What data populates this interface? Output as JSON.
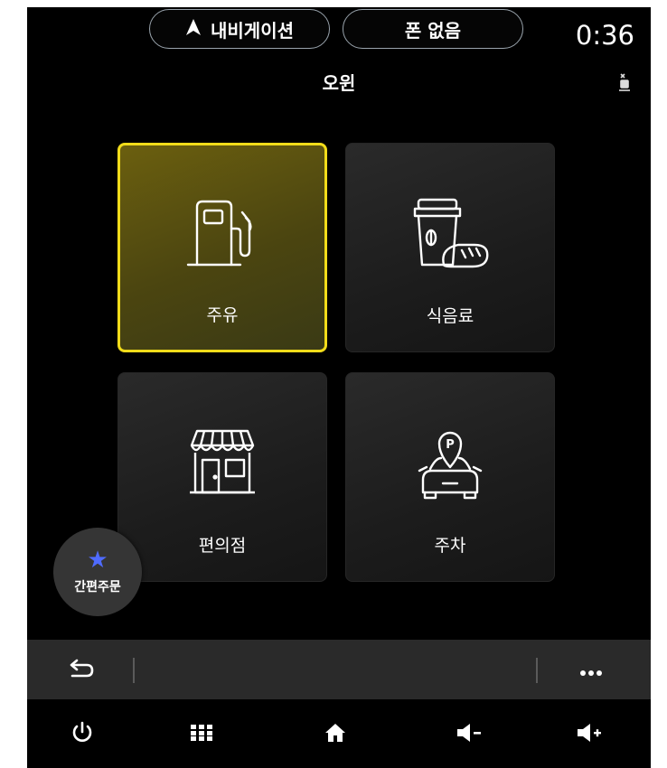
{
  "header": {
    "nav_pill_label": "내비게이션",
    "phone_pill_label": "폰 없음",
    "clock": "0:36",
    "title": "오윈"
  },
  "tiles": [
    {
      "label": "주유",
      "icon": "fuel-pump-icon",
      "selected": true
    },
    {
      "label": "식음료",
      "icon": "coffee-bread-icon",
      "selected": false
    },
    {
      "label": "편의점",
      "icon": "store-icon",
      "selected": false
    },
    {
      "label": "주차",
      "icon": "parking-car-icon",
      "selected": false
    }
  ],
  "quick_order": {
    "label": "간편주문",
    "icon": "star-icon"
  },
  "action_bar": {
    "back_icon": "back-arrow-icon",
    "more_icon": "more-dots-icon"
  },
  "bottom_bar": [
    "power-icon",
    "apps-grid-icon",
    "home-icon",
    "volume-down-icon",
    "volume-up-icon"
  ],
  "colors": {
    "selected_border": "#f2dc1a",
    "selected_fill": "#5a5212",
    "tile_fill": "#222222",
    "quick_star": "#4f6bff",
    "background": "#000000"
  }
}
